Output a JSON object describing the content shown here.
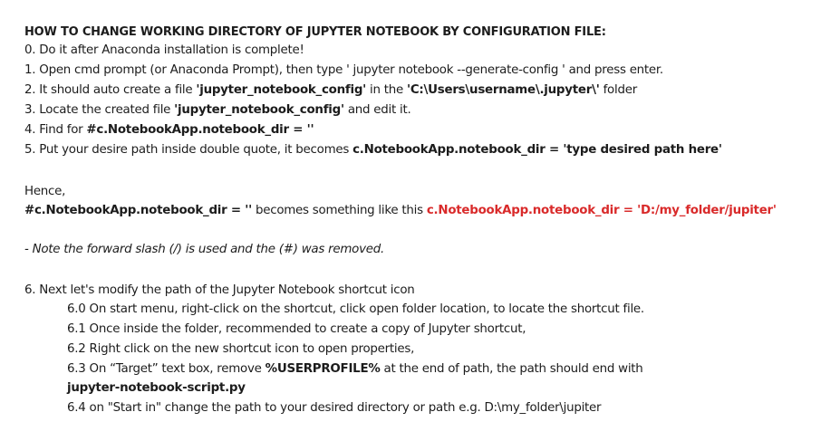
{
  "title": "HOW TO CHANGE WORKING DIRECTORY OF JUPYTER NOTEBOOK BY CONFIGURATION FILE:",
  "steps": {
    "s0": "0.  Do it after Anaconda installation is complete!",
    "s1": "1.  Open cmd prompt (or Anaconda Prompt), then type ' jupyter notebook --generate-config ' and press enter.",
    "s2_a": "2. It should auto create a file ",
    "s2_b": "'jupyter_notebook_config'",
    "s2_c": " in the ",
    "s2_d": "'C:\\Users\\username\\.jupyter\\'",
    "s2_e": " folder",
    "s3_a": "3. Locate the created file ",
    "s3_b": "'jupyter_notebook_config'",
    "s3_c": " and edit it.",
    "s4_a": "4. Find for ",
    "s4_b": "#c.NotebookApp.notebook_dir = ''",
    "s5_a": "5. Put your desire path inside double quote, it becomes ",
    "s5_b": "c.NotebookApp.notebook_dir = 'type desired path here'"
  },
  "hence": {
    "label": "Hence,",
    "code_before": "#c.NotebookApp.notebook_dir = ''",
    "middle": " becomes something like this ",
    "code_after": "c.NotebookApp.notebook_dir = 'D:/my_folder/jupiter'"
  },
  "note": "- Note the forward slash (/) is used and the (#) was removed.",
  "step6": {
    "heading": "6. Next let's modify the path of the Jupyter Notebook shortcut icon",
    "s6_0": "6.0 On start menu, right-click on the shortcut, click open folder location, to locate the shortcut file.",
    "s6_1": "6.1 Once inside the folder, recommended to create a copy of Jupyter shortcut,",
    "s6_2": "6.2 Right click on the new shortcut icon to open properties,",
    "s6_3_a": "6.3 On “Target” text box, remove ",
    "s6_3_b": "%USERPROFILE%",
    "s6_3_c": " at the end of path, the path should end with",
    "s6_3_d": "jupyter-notebook-script.py",
    "s6_4": "6.4 on \"Start in\" change the path to your desired directory or path e.g. D:\\my_folder\\jupiter"
  }
}
